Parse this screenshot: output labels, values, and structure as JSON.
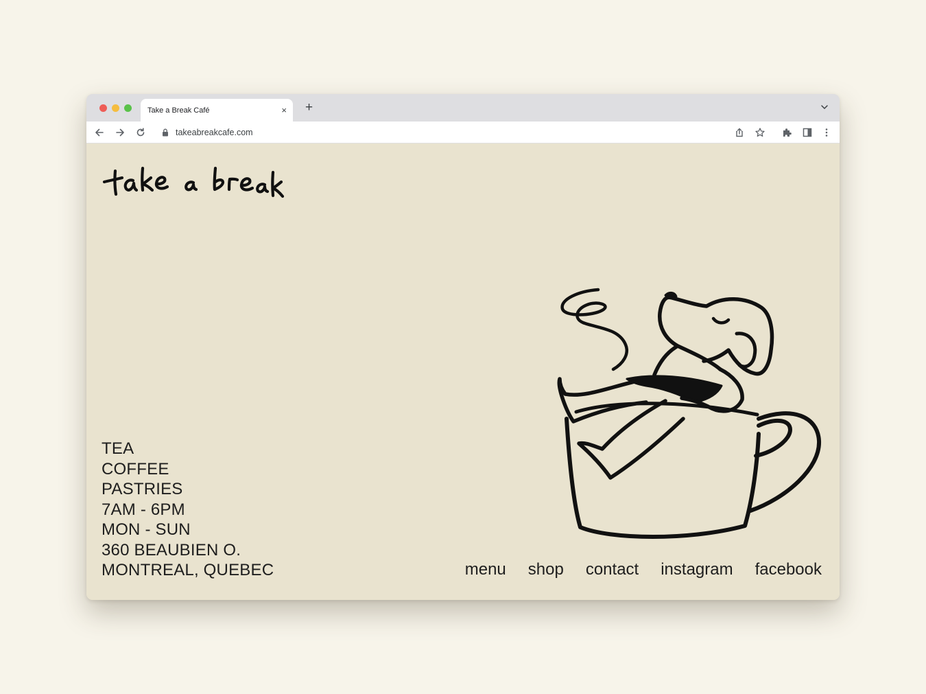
{
  "browser": {
    "tab_title": "Take a Break Café",
    "tab_close": "×",
    "new_tab": "+",
    "url": "takeabreakcafe.com"
  },
  "site": {
    "logo_text": "take a break",
    "info": [
      "TEA",
      "COFFEE",
      "PASTRIES",
      "7AM - 6PM",
      "MON - SUN",
      "360 BEAUBIEN O.",
      "MONTREAL, QUEBEC"
    ],
    "nav": [
      "menu",
      "shop",
      "contact",
      "instagram",
      "facebook"
    ]
  },
  "colors": {
    "page_bg": "#f7f4ea",
    "site_bg": "#e9e3cf",
    "ink": "#1e1e1e"
  },
  "icons": [
    "back-arrow-icon",
    "forward-arrow-icon",
    "reload-icon",
    "lock-icon",
    "share-icon",
    "star-icon",
    "extensions-icon",
    "side-panel-icon",
    "kebab-menu-icon",
    "chevron-down-icon"
  ]
}
